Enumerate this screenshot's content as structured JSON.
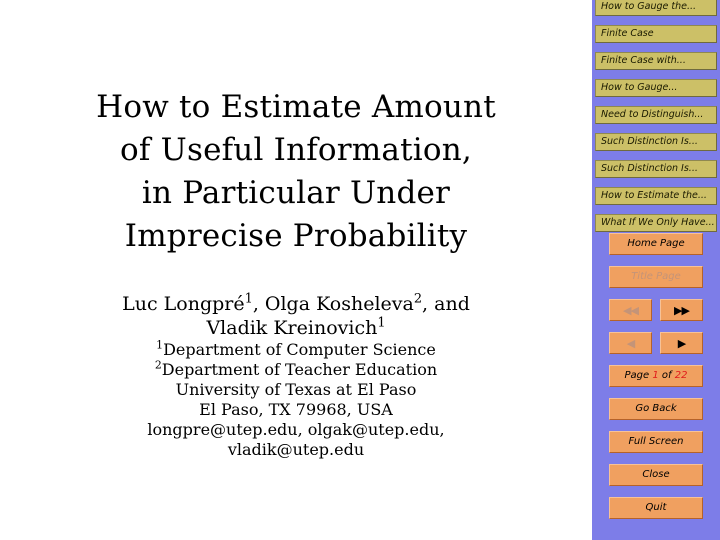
{
  "slide": {
    "title_lines": [
      "How to Estimate Amount",
      "of Useful Information,",
      "in Particular Under",
      "Imprecise Probability"
    ],
    "author_line_1_a": "Luc Longpré",
    "author_line_1_sup_a": "1",
    "author_line_1_b": ", Olga Kosheleva",
    "author_line_1_sup_b": "2",
    "author_line_1_c": ", and",
    "author_line_2_a": "Vladik Kreinovich",
    "author_line_2_sup": "1",
    "affiliation_1_sup": "1",
    "affiliation_1": "Department of Computer Science",
    "affiliation_2_sup": "2",
    "affiliation_2": "Department of Teacher Education",
    "affiliation_3": "University of Texas at El Paso",
    "affiliation_4": "El Paso, TX 79968, USA",
    "emails_line_1": "longpre@utep.edu, olgak@utep.edu,",
    "emails_line_2": "vladik@utep.edu"
  },
  "sidebar": {
    "background_color": "#7d7de8",
    "nav_item_color": "#ccc067",
    "button_color": "#f0a060",
    "nav_items": [
      {
        "label": "How to Gauge the..."
      },
      {
        "label": "Finite Case"
      },
      {
        "label": "Finite Case with..."
      },
      {
        "label": "How to Gauge..."
      },
      {
        "label": "Need to Distinguish..."
      },
      {
        "label": "Such Distinction Is..."
      },
      {
        "label": "Such Distinction Is..."
      },
      {
        "label": "How to Estimate the..."
      },
      {
        "label": "What If We Only Have..."
      }
    ],
    "buttons": {
      "home_page": "Home Page",
      "title_page": "Title Page",
      "prev_section_icon": "double-left-arrow-icon",
      "next_section_icon": "double-right-arrow-icon",
      "prev_page_icon": "left-arrow-icon",
      "next_page_icon": "right-arrow-icon",
      "prev_section_glyph": "◀◀",
      "next_section_glyph": "▶▶",
      "prev_page_glyph": "◀",
      "next_page_glyph": "▶",
      "page_word": "Page",
      "page_current": "1",
      "page_of": "of",
      "page_total": "22",
      "go_back": "Go Back",
      "full_screen": "Full Screen",
      "close": "Close",
      "quit": "Quit"
    }
  }
}
